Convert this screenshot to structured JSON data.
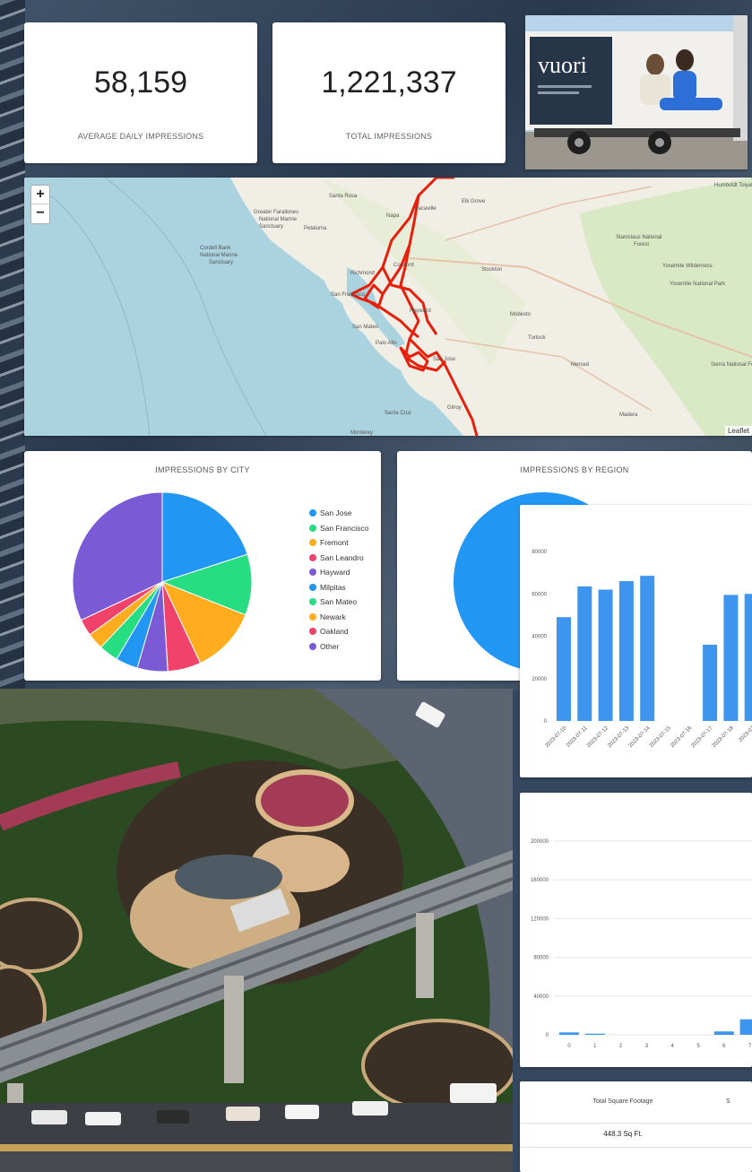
{
  "kpis": {
    "average_daily": {
      "value": "58,159",
      "label": "AVERAGE DAILY IMPRESSIONS"
    },
    "total": {
      "value": "1,221,337",
      "label": "TOTAL IMPRESSIONS"
    }
  },
  "ad_photo": {
    "brand": "vuori"
  },
  "map": {
    "zoom_in": "+",
    "zoom_out": "−",
    "attribution": "Leaflet",
    "places": [
      "Santa Rosa",
      "Petaluma",
      "Napa",
      "Vacaville",
      "Elk Grove",
      "Greater Farallones National Marine Sanctuary",
      "Cordell Bank National Marine Sanctuary",
      "Richmond",
      "Concord",
      "Stockton",
      "San Francisco",
      "Hayward",
      "Modesto",
      "Turlock",
      "San Mateo",
      "Palo Alto",
      "San Jose",
      "Merced",
      "Santa Cruz",
      "Gilroy",
      "Madera",
      "Monterey",
      "Stanislaus National Forest",
      "Yosemite Wilderness",
      "Yosemite National Park",
      "Sierra National Forest",
      "Humboldt Toiyabe National Forest"
    ]
  },
  "pie_city": {
    "title": "IMPRESSIONS BY CITY",
    "legend": [
      {
        "label": "San Jose",
        "color": "#2196f3"
      },
      {
        "label": "San Francisco",
        "color": "#26de81"
      },
      {
        "label": "Fremont",
        "color": "#ffad1f"
      },
      {
        "label": "San Leandro",
        "color": "#f0426a"
      },
      {
        "label": "Hayward",
        "color": "#7b5ad6"
      },
      {
        "label": "Milpitas",
        "color": "#2196f3"
      },
      {
        "label": "San Mateo",
        "color": "#26de81"
      },
      {
        "label": "Newark",
        "color": "#ffad1f"
      },
      {
        "label": "Oakland",
        "color": "#f0426a"
      },
      {
        "label": "Other",
        "color": "#7b5ad6"
      }
    ]
  },
  "pie_region": {
    "title": "IMPRESSIONS BY REGION",
    "color": "#2196f3"
  },
  "bar_daily": {
    "ylabels": [
      "80000",
      "60000",
      "40000",
      "20000",
      "0"
    ],
    "bar_color": "#3d95ed"
  },
  "bar_hourly": {
    "ylabels": [
      "200000",
      "160000",
      "120000",
      "80000",
      "40000",
      "0"
    ],
    "bar_color": "#3d95ed"
  },
  "table": {
    "headers": [
      "Total Square Footage",
      "S"
    ],
    "values": [
      "448.3 Sq Ft.",
      ""
    ]
  },
  "chart_data": [
    {
      "type": "pie",
      "title": "IMPRESSIONS BY CITY",
      "categories": [
        "San Jose",
        "San Francisco",
        "Fremont",
        "San Leandro",
        "Hayward",
        "Milpitas",
        "San Mateo",
        "Newark",
        "Oakland",
        "Other"
      ],
      "values": [
        20,
        11,
        12,
        6,
        5.5,
        4,
        3.5,
        3,
        3,
        32
      ],
      "legend": "right"
    },
    {
      "type": "pie",
      "title": "IMPRESSIONS BY REGION",
      "categories": [],
      "values": [
        100
      ]
    },
    {
      "type": "bar",
      "categories": [
        "2023-07-10",
        "2023-07-11",
        "2023-07-12",
        "2023-07-13",
        "2023-07-14",
        "2023-07-15",
        "2023-07-16",
        "2023-07-17",
        "2023-07-18",
        "2023-07"
      ],
      "values": [
        49000,
        63500,
        62000,
        66000,
        68500,
        0,
        0,
        36000,
        59500,
        60000
      ],
      "ylim": [
        0,
        80000
      ],
      "grid": false
    },
    {
      "type": "bar",
      "categories": [
        "0",
        "1",
        "2",
        "3",
        "4",
        "5",
        "6",
        "7"
      ],
      "values": [
        2500,
        1200,
        0,
        0,
        0,
        0,
        3500,
        16000
      ],
      "ylim": [
        0,
        200000
      ],
      "grid": true
    }
  ]
}
